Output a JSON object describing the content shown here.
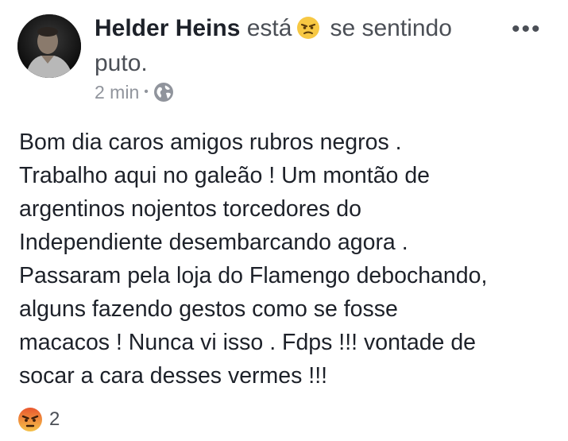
{
  "post": {
    "author": "Helder Heins",
    "feeling_prefix": "está",
    "feeling_emoji_icon": "angry-face-icon",
    "feeling_suffix": "se sentindo",
    "feeling_word": "puto.",
    "timestamp": "2 min",
    "separator": "•",
    "privacy_icon": "globe-icon",
    "menu_label": "•••",
    "text": "Bom dia caros amigos rubros negros .\nTrabalho aqui no galeão ! Um montão de\nargentinos nojentos torcedores do\nIndependiente desembarcando agora .\nPassaram pela loja do Flamengo debochando,\nalguns fazendo gestos como se fosse\nmacacos ! Nunca vi isso . Fdps !!! vontade de\nsocar a cara desses vermes !!!"
  },
  "reactions": {
    "icon": "angry-reaction-icon",
    "count": "2"
  },
  "colors": {
    "author": "#1d2129",
    "muted_text": "#4b4f56",
    "meta_text": "#90949c",
    "emoji_yellow": "#f7c843",
    "reaction_angry_top": "#e9572e",
    "reaction_angry_bottom": "#f5c24a"
  }
}
